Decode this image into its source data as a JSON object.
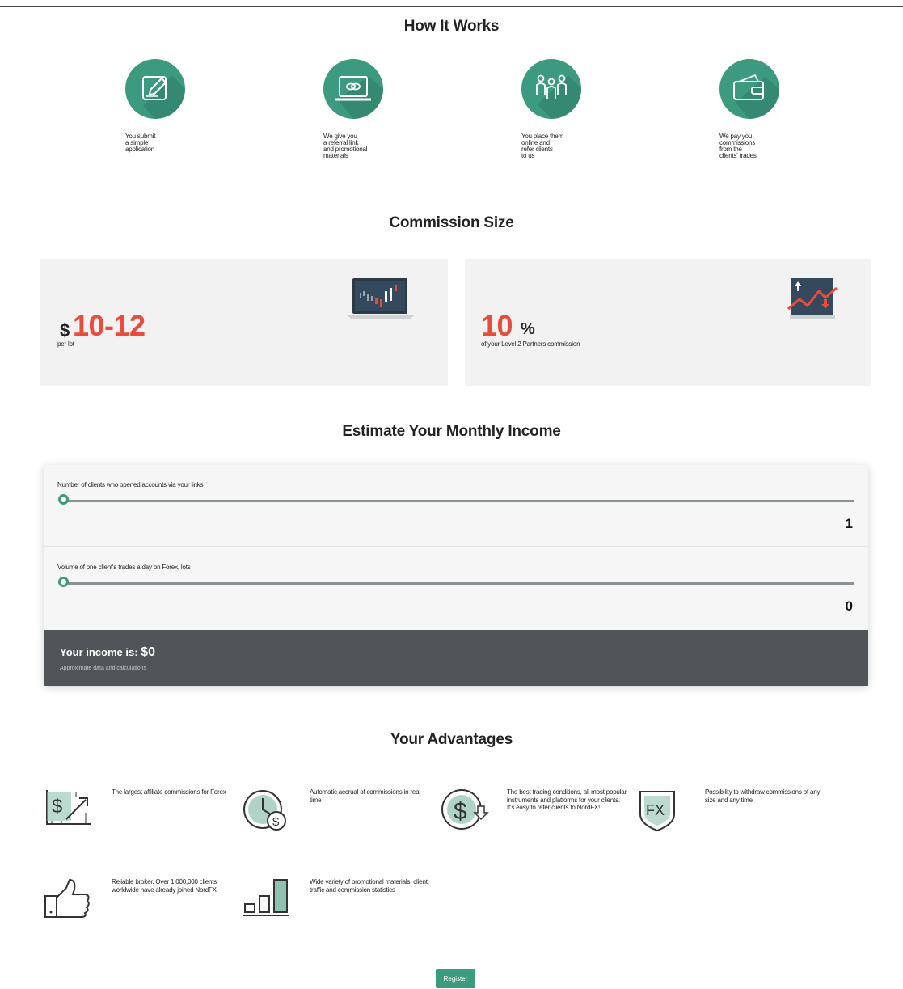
{
  "how_it_works": {
    "title": "How It Works",
    "steps": [
      {
        "icon": "pencil-edit-icon",
        "text": "You submit\na simple\napplication"
      },
      {
        "icon": "laptop-link-icon",
        "text": "We give you\na referral link\nand promotional\nmaterials"
      },
      {
        "icon": "people-group-icon",
        "text": "You place them\nonline and\nrefer clients\nto us"
      },
      {
        "icon": "wallet-icon",
        "text": "We pay you\ncommissions\nfrom the\nclients' trades"
      }
    ]
  },
  "commission": {
    "title": "Commission Size",
    "left": {
      "currency": "$",
      "amount": "10-12",
      "caption": "per lot",
      "icon": "laptop-chart-icon"
    },
    "right": {
      "amount": "10",
      "unit": "%",
      "caption": "of your Level 2 Partners commission",
      "icon": "trend-chart-icon"
    }
  },
  "estimate": {
    "title": "Estimate Your Monthly Income",
    "sliders": [
      {
        "label": "Number of clients who opened accounts via your links",
        "value": "1",
        "position": 0.0
      },
      {
        "label": "Volume of one client's trades a day on Forex, lots",
        "value": "0",
        "position": 0.0
      }
    ],
    "income_label": "Your income is:",
    "income_value": "$0",
    "note": "Approximate data and calculations"
  },
  "advantages": {
    "title": "Your Advantages",
    "items": [
      {
        "icon": "dollar-chart-icon",
        "text": "The largest affiliate commissions for Forex"
      },
      {
        "icon": "clock-dollar-icon",
        "text": "Automatic accrual of commissions in real time"
      },
      {
        "icon": "dollar-cycle-icon",
        "text": "The best trading conditions, all most popular instruments and platforms for your clients. It's easy to refer clients to NordFX!"
      },
      {
        "icon": "fx-shield-icon",
        "text": "Possibility to withdraw commissions of any size and any time"
      },
      {
        "icon": "thumbs-up-icon",
        "text": "Reliable broker. Over 1,000,000 clients worldwide have already joined NordFX"
      },
      {
        "icon": "bar-stats-icon",
        "text": "Wide variety of promotional materials; client, traffic and commission statistics"
      }
    ]
  },
  "register_label": "Register",
  "colors": {
    "accent": "#3c9a7e",
    "highlight": "#e74c3c",
    "panel": "#f2f2f2",
    "income_bar": "#505558"
  }
}
